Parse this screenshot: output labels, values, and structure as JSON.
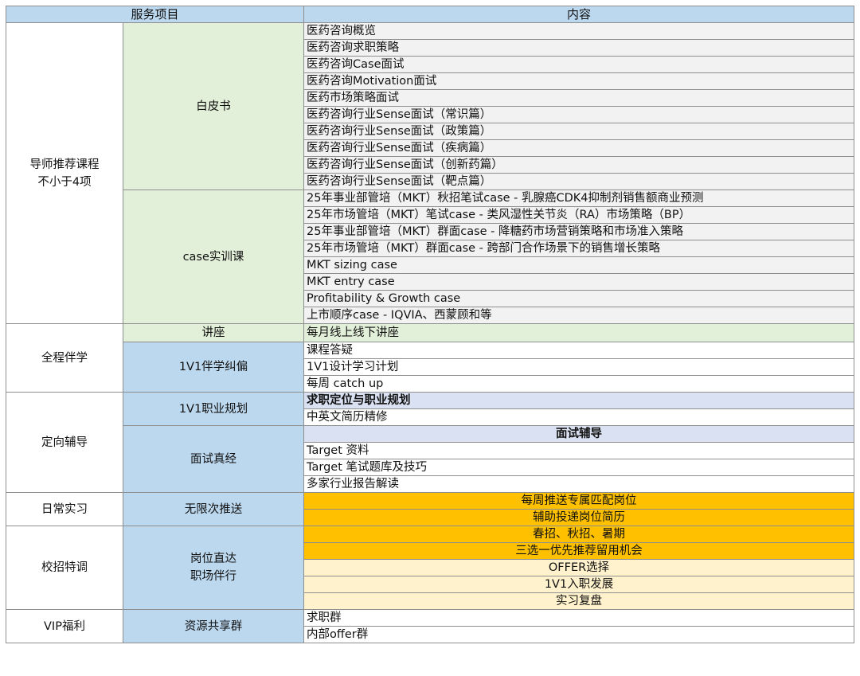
{
  "header": {
    "col1": "服务项目",
    "col3": "内容"
  },
  "groups": [
    {
      "category": "导师推荐课程\n不小于4项",
      "subgroups": [
        {
          "name": "白皮书",
          "items": [
            "医药咨询概览",
            "医药咨询求职策略",
            "医药咨询Case面试",
            "医药咨询Motivation面试",
            "医药市场策略面试",
            "医药咨询行业Sense面试（常识篇）",
            "医药咨询行业Sense面试（政策篇）",
            "医药咨询行业Sense面试（疾病篇）",
            "医药咨询行业Sense面试（创新药篇）",
            "医药咨询行业Sense面试（靶点篇）"
          ]
        },
        {
          "name": "case实训课",
          "items": [
            "25年事业部管培（MKT）秋招笔试case - 乳腺癌CDK4抑制剂销售额商业预测",
            "25年市场管培（MKT）笔试case - 类风湿性关节炎（RA）市场策略（BP）",
            "25年事业部管培（MKT）群面case - 降糖药市场营销策略和市场准入策略",
            "25年市场管培（MKT）群面case - 跨部门合作场景下的销售增长策略",
            "MKT sizing case",
            "MKT entry case",
            "Profitability & Growth case",
            "上市顺序case - IQVIA、西蒙顾和等"
          ]
        }
      ]
    },
    {
      "category": "全程伴学",
      "subgroups": [
        {
          "name": "讲座",
          "items": [
            "每月线上线下讲座"
          ]
        },
        {
          "name": "1V1伴学纠偏",
          "items": [
            "课程答疑",
            "1V1设计学习计划",
            "每周 catch up"
          ]
        }
      ]
    },
    {
      "category": "定向辅导",
      "subgroups": [
        {
          "name": "1V1职业规划",
          "items": [
            "求职定位与职业规划",
            "中英文简历精修"
          ]
        },
        {
          "name": "面试真经",
          "items": [
            "面试辅导",
            "Target 资料",
            "Target 笔试题库及技巧",
            "多家行业报告解读"
          ]
        }
      ]
    },
    {
      "category": "日常实习",
      "subgroups": [
        {
          "name": "无限次推送",
          "items": [
            "每周推送专属匹配岗位",
            "辅助投递岗位简历"
          ]
        }
      ]
    },
    {
      "category": "校招特调",
      "subgroups": [
        {
          "name": "岗位直达\n职场伴行",
          "items": [
            "春招、秋招、暑期",
            "三选一优先推荐留用机会",
            "OFFER选择",
            "1V1入职发展",
            "实习复盘"
          ]
        }
      ]
    },
    {
      "category": "VIP福利",
      "subgroups": [
        {
          "name": "资源共享群",
          "items": [
            "求职群",
            "内部offer群"
          ]
        }
      ]
    }
  ]
}
